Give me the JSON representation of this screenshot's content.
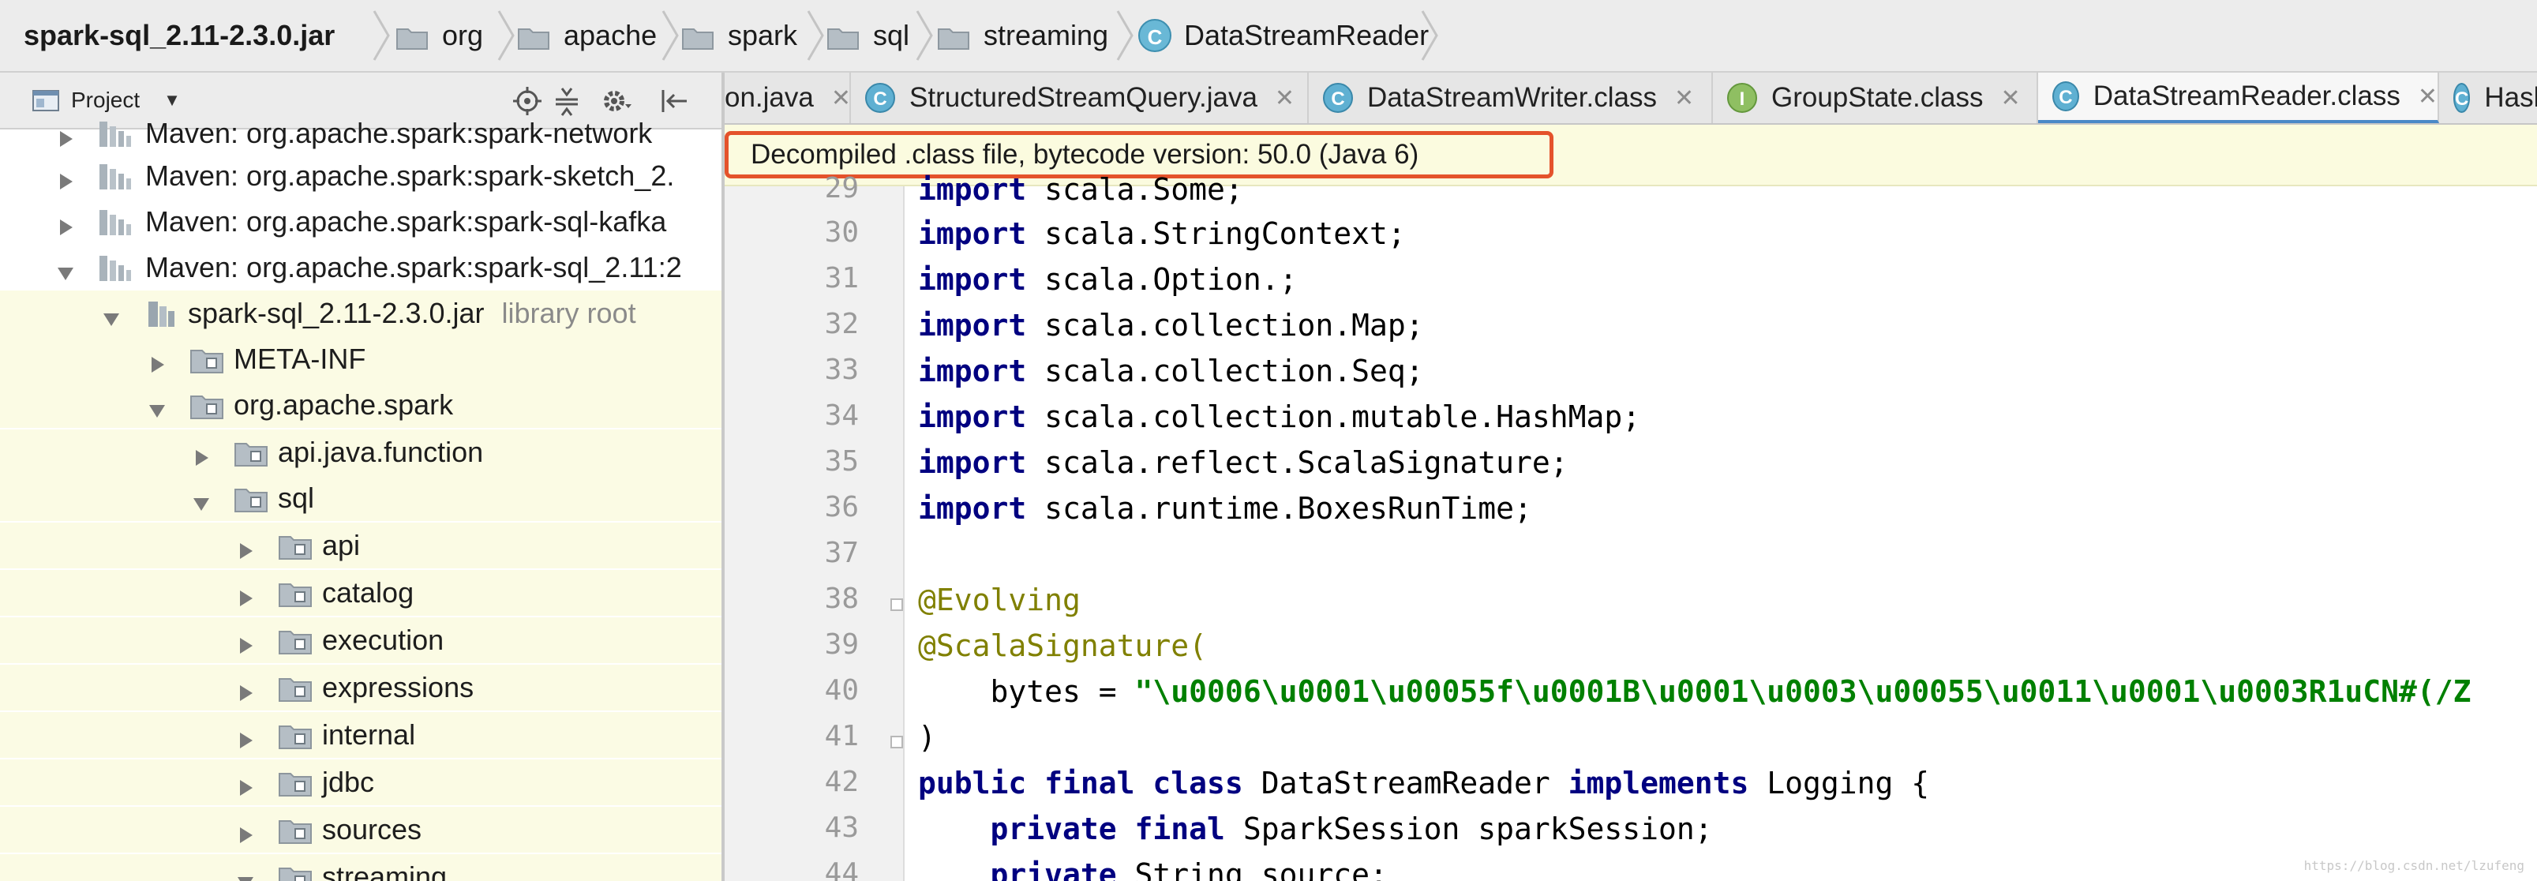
{
  "breadcrumb": {
    "jar": "spark-sql_2.11-2.3.0.jar",
    "items": [
      "org",
      "apache",
      "spark",
      "sql",
      "streaming"
    ],
    "class_badge": "C",
    "class_name": "DataStreamReader"
  },
  "project": {
    "title": "Project",
    "tree": [
      {
        "label": "Maven: org.apache.spark:spark-network"
      },
      {
        "label": "Maven: org.apache.spark:spark-sketch_2."
      },
      {
        "label": "Maven: org.apache.spark:spark-sql-kafka"
      },
      {
        "label": "Maven: org.apache.spark:spark-sql_2.11:2"
      },
      {
        "label": "spark-sql_2.11-2.3.0.jar",
        "note": "library root"
      },
      {
        "label": "META-INF"
      },
      {
        "label": "org.apache.spark"
      },
      {
        "label": "api.java.function"
      },
      {
        "label": "sql"
      },
      {
        "label": "api"
      },
      {
        "label": "catalog"
      },
      {
        "label": "execution"
      },
      {
        "label": "expressions"
      },
      {
        "label": "internal"
      },
      {
        "label": "jdbc"
      },
      {
        "label": "sources"
      },
      {
        "label": "streaming"
      }
    ]
  },
  "tabs": [
    {
      "label": "on.java",
      "badge": "",
      "badge_type": ""
    },
    {
      "label": "StructuredStreamQuery.java",
      "badge": "C",
      "badge_type": "class"
    },
    {
      "label": "DataStreamWriter.class",
      "badge": "C",
      "badge_type": "class"
    },
    {
      "label": "GroupState.class",
      "badge": "I",
      "badge_type": "interface"
    },
    {
      "label": "DataStreamReader.class",
      "badge": "C",
      "badge_type": "class",
      "active": true
    },
    {
      "label": "Hash",
      "badge": "C",
      "badge_type": "class"
    }
  ],
  "tab_close": "✕",
  "notice": "Decompiled .class file, bytecode version: 50.0 (Java 6)",
  "code": {
    "line_numbers": [
      "29",
      "30",
      "31",
      "32",
      "33",
      "34",
      "35",
      "36",
      "37",
      "38",
      "39",
      "40",
      "41",
      "42",
      "43",
      "44"
    ],
    "lines": [
      {
        "kw": "import",
        "rest": " scala.Some;"
      },
      {
        "kw": "import",
        "rest": " scala.StringContext;"
      },
      {
        "kw": "import",
        "rest": " scala.Option.;"
      },
      {
        "kw": "import",
        "rest": " scala.collection.Map;"
      },
      {
        "kw": "import",
        "rest": " scala.collection.Seq;"
      },
      {
        "kw": "import",
        "rest": " scala.collection.mutable.HashMap;"
      },
      {
        "kw": "import",
        "rest": " scala.reflect.ScalaSignature;"
      },
      {
        "kw": "import",
        "rest": " scala.runtime.BoxesRunTime;"
      },
      {
        "kw": "",
        "rest": ""
      },
      {
        "ann": "@Evolving"
      },
      {
        "ann": "@ScalaSignature("
      },
      {
        "bytes_prefix": "    bytes = ",
        "str": "\"\\u0006\\u0001\\u00055f\\u0001B\\u0001\\u0003\\u00055\\u0011\\u0001\\u0003R1uCN#(/Z"
      },
      {
        "rest": ")"
      },
      {
        "kw": "public final class",
        "rest": " DataStreamReader ",
        "kw2": "implements",
        "rest2": " Logging {"
      },
      {
        "indent": "    ",
        "kw": "private final",
        "rest": " SparkSession sparkSession;"
      },
      {
        "indent": "    ",
        "kw": "private",
        "rest": " String source;"
      }
    ]
  },
  "watermark": "https://blog.csdn.net/lzufeng",
  "colors": {
    "notice_border": "#e4522b",
    "keyword": "#000080",
    "annotation": "#808000",
    "string": "#008000"
  }
}
